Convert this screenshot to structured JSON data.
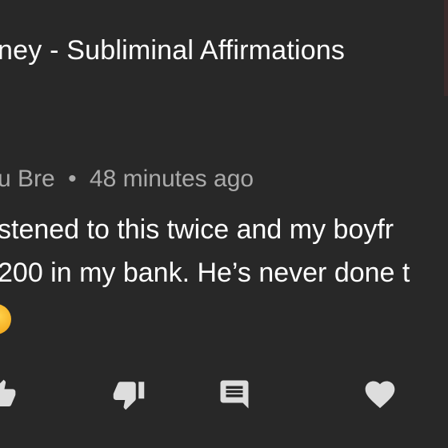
{
  "video": {
    "title": "ney - Subliminal Affirmations"
  },
  "comment": {
    "author": "u Bre",
    "separator": "•",
    "time": "48 minutes ago",
    "lines": [
      "stened to this twice and my boyfr",
      "200 in my bank. He’s never done t"
    ]
  },
  "actions": {
    "like": "thumbs-up-icon",
    "dislike": "thumbs-down-icon",
    "reply": "comment-icon",
    "heart": "heart-icon"
  },
  "colors": {
    "background": "#282828",
    "text": "#ffffff",
    "meta": "#aaaaaa",
    "icon": "#dddddd"
  }
}
